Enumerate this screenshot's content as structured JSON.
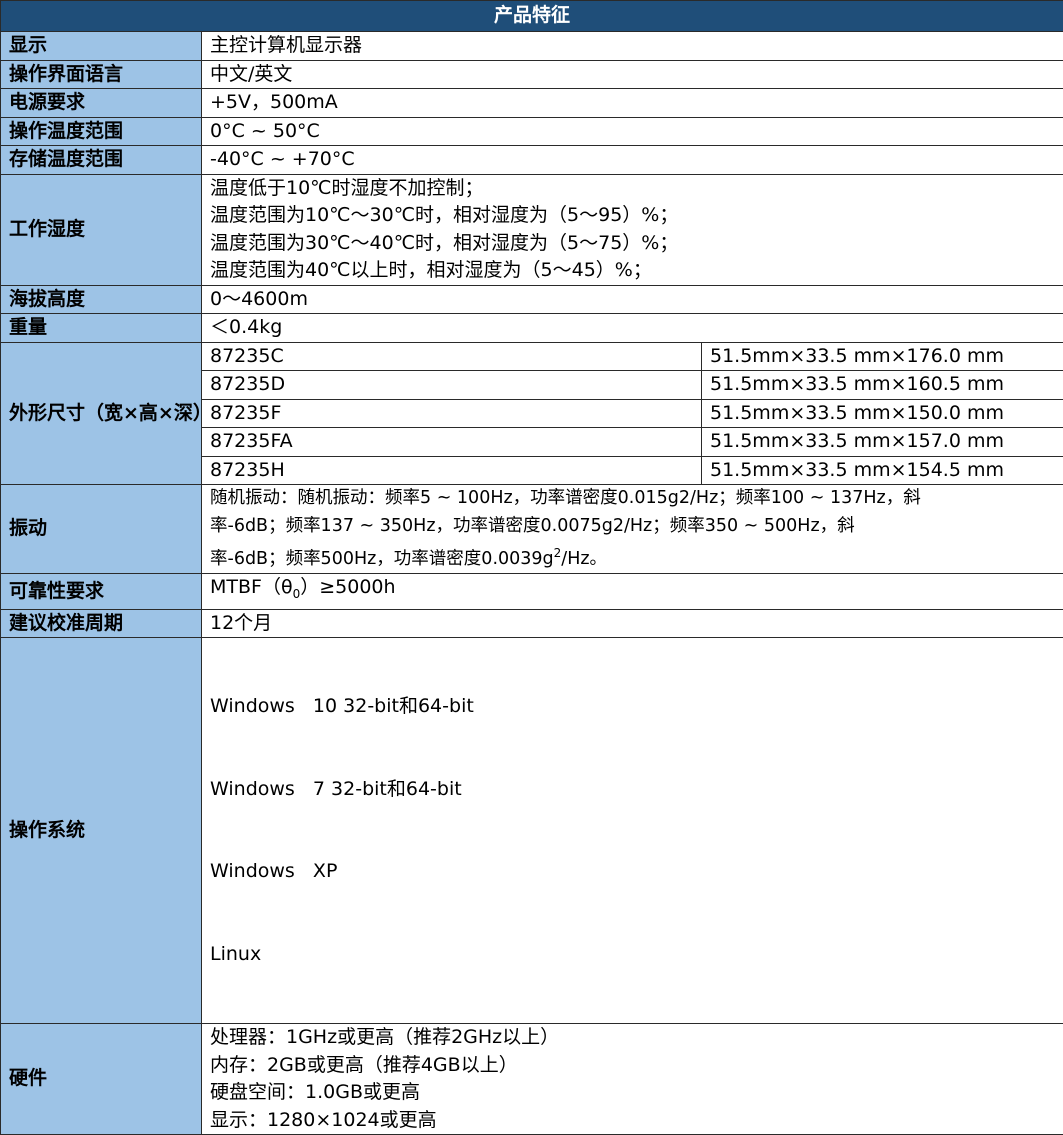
{
  "table": {
    "title": "产品特征",
    "rows": {
      "display": {
        "label": "显示",
        "value": "主控计算机显示器"
      },
      "language": {
        "label": "操作界面语言",
        "value": "中文/英文"
      },
      "power": {
        "label": "电源要求",
        "value": "+5V，500mA"
      },
      "op_temp": {
        "label": "操作温度范围",
        "value": "0°C ~ 50°C"
      },
      "storage_temp": {
        "label": "存储温度范围",
        "value": "-40°C ~ +70°C"
      },
      "humidity": {
        "label": "工作湿度",
        "lines": [
          "温度低于10℃时湿度不加控制；",
          "温度范围为10℃～30℃时，相对湿度为（5～95）%；",
          "温度范围为30℃～40℃时，相对湿度为（5～75）%；",
          "温度范围为40℃以上时，相对湿度为（5～45）%；"
        ]
      },
      "altitude": {
        "label": "海拔高度",
        "value": "0～4600m"
      },
      "weight": {
        "label": "重量",
        "value": "＜0.4kg"
      },
      "dimensions": {
        "label": "外形尺寸（宽×高×深）",
        "models": [
          {
            "model": "87235C",
            "size": "51.5mm×33.5 mm×176.0 mm"
          },
          {
            "model": "87235D",
            "size": "51.5mm×33.5 mm×160.5 mm"
          },
          {
            "model": "87235F",
            "size": "51.5mm×33.5 mm×150.0 mm"
          },
          {
            "model": "87235FA",
            "size": "51.5mm×33.5 mm×157.0 mm"
          },
          {
            "model": "87235H",
            "size": "51.5mm×33.5 mm×154.5 mm"
          }
        ]
      },
      "vibration": {
        "label": "振动",
        "line1": "随机振动：随机振动：频率5 ~ 100Hz，功率谱密度0.015g2/Hz；频率100 ~ 137Hz，斜",
        "line2": "率-6dB；频率137 ~ 350Hz，功率谱密度0.0075g2/Hz；频率350 ~ 500Hz，斜",
        "line3_pre": "率-6dB；频率500Hz，功率谱密度0.0039g",
        "line3_sup": "2",
        "line3_post": "/Hz。"
      },
      "reliability": {
        "label": "可靠性要求",
        "value_pre": "MTBF（θ",
        "value_sub": "0",
        "value_post": "）≥5000h"
      },
      "calibration": {
        "label": "建议校准周期",
        "value": "12个月"
      },
      "os": {
        "label": "操作系统",
        "lines": [
          "Windows   10 32-bit和64-bit",
          "Windows   7 32-bit和64-bit",
          "Windows   XP",
          "Linux"
        ]
      },
      "hardware": {
        "label": "硬件",
        "lines": [
          "处理器：1GHz或更高（推荐2GHz以上）",
          "内存：2GB或更高（推荐4GB以上）",
          "硬盘空间：1.0GB或更高",
          "显示：1280×1024或更高"
        ]
      }
    }
  }
}
